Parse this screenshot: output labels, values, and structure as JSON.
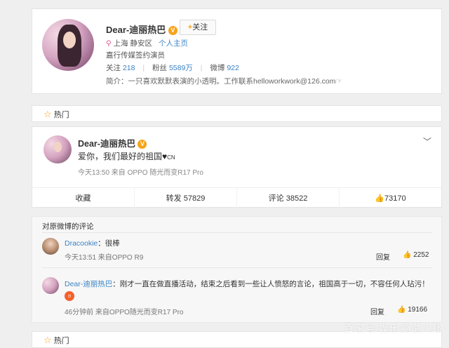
{
  "profile": {
    "name": "Dear-迪丽热巴",
    "follow_label": "关注",
    "location": "上海 静安区",
    "homepage_link": "个人主页",
    "job": "嘉行传媒签约演员",
    "following_label": "关注",
    "following_count": "218",
    "fans_label": "粉丝",
    "fans_count": "5589万",
    "weibo_label": "微博",
    "weibo_count": "922",
    "bio": "简介：一只喜欢默默表演的小透明。工作联系helloworkwork@126.com"
  },
  "hot_label": "热门",
  "post": {
    "author": "Dear-迪丽热巴",
    "text": "爱你，我们最好的祖国",
    "text_suffix": "CN",
    "meta": "今天13:50 来自 OPPO 随光而变R17 Pro",
    "actions": {
      "collect": "收藏",
      "repost_label": "转发",
      "repost_count": "57829",
      "comment_label": "评论",
      "comment_count": "38522",
      "like_count": "73170"
    }
  },
  "comments": {
    "title": "对原微博的评论",
    "items": [
      {
        "user": "Dracookie",
        "text": "：很棒",
        "meta": "今天13:51 来自OPPO R9",
        "reply": "回复",
        "likes": "2252"
      },
      {
        "user": "Dear-迪丽热巴",
        "text": "：刚才一直在做直播活动，结束之后看到一些让人愤怒的言论，祖国高于一切，不容任何人玷污！",
        "meta": "46分钟前 来自OPPO随光而变R17 Pro",
        "reply": "回复",
        "likes": "19166"
      }
    ]
  },
  "watermark": "百家号/娱乐爱说八卦",
  "colors": {
    "link": "#3b83c4",
    "accent": "#f7a31a",
    "background": "#efefef"
  }
}
